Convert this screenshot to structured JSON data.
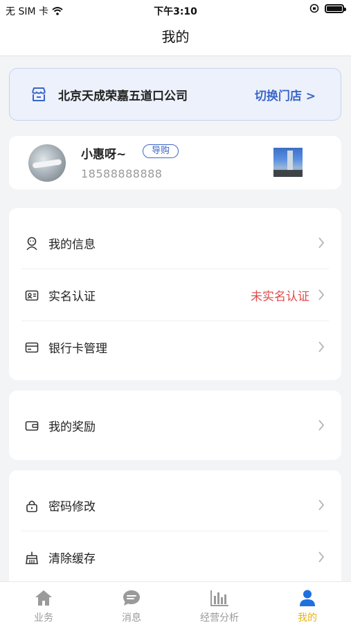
{
  "status_bar": {
    "carrier": "无 SIM 卡",
    "time": "下午3:10"
  },
  "nav": {
    "title": "我的"
  },
  "store": {
    "name": "北京天成荣嘉五道口公司",
    "switch_label": "切换门店 >"
  },
  "profile": {
    "name": "小惠呀~",
    "role": "导购",
    "phone": "18588888888"
  },
  "menu_group_1": {
    "items": [
      {
        "label": "我的信息",
        "icon": "user-icon"
      },
      {
        "label": "实名认证",
        "icon": "id-card-icon",
        "value": "未实名认证"
      },
      {
        "label": "银行卡管理",
        "icon": "bank-card-icon"
      }
    ]
  },
  "menu_group_2": {
    "items": [
      {
        "label": "我的奖励",
        "icon": "wallet-icon"
      }
    ]
  },
  "menu_group_3": {
    "items": [
      {
        "label": "密码修改",
        "icon": "lock-icon"
      },
      {
        "label": "清除缓存",
        "icon": "broom-icon"
      }
    ]
  },
  "tabs": [
    {
      "label": "业务",
      "icon": "home-icon"
    },
    {
      "label": "消息",
      "icon": "message-icon"
    },
    {
      "label": "经营分析",
      "icon": "bar-chart-icon"
    },
    {
      "label": "我的",
      "icon": "person-icon",
      "active": true
    }
  ],
  "colors": {
    "accent_blue": "#3a66c9",
    "warning_red": "#e14b4b",
    "active_tab": "#e7b21b"
  }
}
